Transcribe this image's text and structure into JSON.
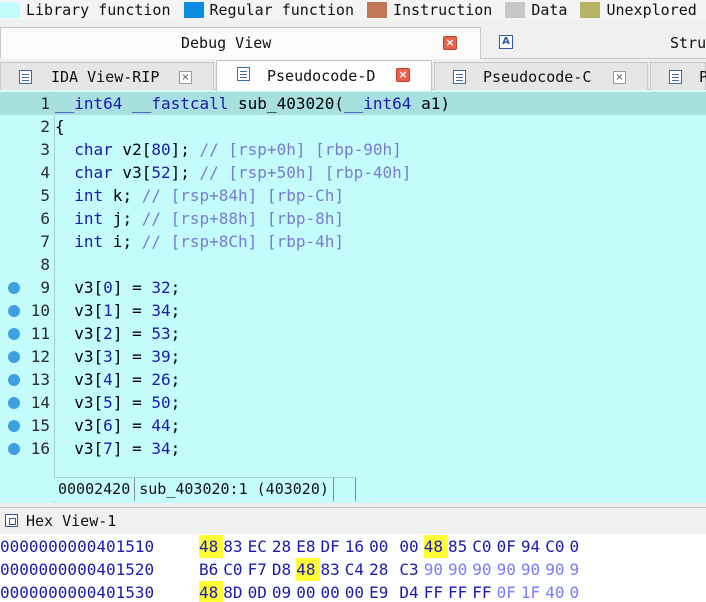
{
  "legend": [
    {
      "label": "Library function",
      "color": "#c4fcfc"
    },
    {
      "label": "Regular function",
      "color": "#0b8ee0"
    },
    {
      "label": "Instruction",
      "color": "#c07858"
    },
    {
      "label": "Data",
      "color": "#c8c8c8"
    },
    {
      "label": "Unexplored",
      "color": "#b4b464"
    }
  ],
  "debug_tab": {
    "label": "Debug View",
    "close": "×"
  },
  "struct_tab": {
    "label": "Stru",
    "icon": "A"
  },
  "sub_tabs": [
    {
      "label": "IDA View-RIP",
      "close": "×"
    },
    {
      "label": "Pseudocode-D",
      "close": "×"
    },
    {
      "label": "Pseudocode-C",
      "close": "×"
    },
    {
      "label": "P"
    }
  ],
  "code": {
    "lines": [
      {
        "num": "1",
        "bp": false,
        "parts": [
          [
            "kw",
            "__int64"
          ],
          [
            "t",
            " "
          ],
          [
            "kw",
            "__fastcall"
          ],
          [
            "t",
            " sub_403020("
          ],
          [
            "kw",
            "__int64"
          ],
          [
            "t",
            " a1)"
          ]
        ]
      },
      {
        "num": "2",
        "bp": false,
        "parts": [
          [
            "t",
            "{"
          ]
        ]
      },
      {
        "num": "3",
        "bp": false,
        "parts": [
          [
            "t",
            "  "
          ],
          [
            "kw",
            "char"
          ],
          [
            "t",
            " v2["
          ],
          [
            "nm",
            "80"
          ],
          [
            "t",
            "]; "
          ],
          [
            "cm",
            "// [rsp+0h] [rbp-90h]"
          ]
        ]
      },
      {
        "num": "4",
        "bp": false,
        "parts": [
          [
            "t",
            "  "
          ],
          [
            "kw",
            "char"
          ],
          [
            "t",
            " v3["
          ],
          [
            "nm",
            "52"
          ],
          [
            "t",
            "]; "
          ],
          [
            "cm",
            "// [rsp+50h] [rbp-40h]"
          ]
        ]
      },
      {
        "num": "5",
        "bp": false,
        "parts": [
          [
            "t",
            "  "
          ],
          [
            "kw",
            "int"
          ],
          [
            "t",
            " k; "
          ],
          [
            "cm",
            "// [rsp+84h] [rbp-Ch]"
          ]
        ]
      },
      {
        "num": "6",
        "bp": false,
        "parts": [
          [
            "t",
            "  "
          ],
          [
            "kw",
            "int"
          ],
          [
            "t",
            " j; "
          ],
          [
            "cm",
            "// [rsp+88h] [rbp-8h]"
          ]
        ]
      },
      {
        "num": "7",
        "bp": false,
        "parts": [
          [
            "t",
            "  "
          ],
          [
            "kw",
            "int"
          ],
          [
            "t",
            " i; "
          ],
          [
            "cm",
            "// [rsp+8Ch] [rbp-4h]"
          ]
        ]
      },
      {
        "num": "8",
        "bp": false,
        "parts": [
          [
            "t",
            ""
          ]
        ]
      },
      {
        "num": "9",
        "bp": true,
        "parts": [
          [
            "t",
            "  v3["
          ],
          [
            "nm",
            "0"
          ],
          [
            "t",
            "] = "
          ],
          [
            "nm",
            "32"
          ],
          [
            "t",
            ";"
          ]
        ]
      },
      {
        "num": "10",
        "bp": true,
        "parts": [
          [
            "t",
            "  v3["
          ],
          [
            "nm",
            "1"
          ],
          [
            "t",
            "] = "
          ],
          [
            "nm",
            "34"
          ],
          [
            "t",
            ";"
          ]
        ]
      },
      {
        "num": "11",
        "bp": true,
        "parts": [
          [
            "t",
            "  v3["
          ],
          [
            "nm",
            "2"
          ],
          [
            "t",
            "] = "
          ],
          [
            "nm",
            "53"
          ],
          [
            "t",
            ";"
          ]
        ]
      },
      {
        "num": "12",
        "bp": true,
        "parts": [
          [
            "t",
            "  v3["
          ],
          [
            "nm",
            "3"
          ],
          [
            "t",
            "] = "
          ],
          [
            "nm",
            "39"
          ],
          [
            "t",
            ";"
          ]
        ]
      },
      {
        "num": "13",
        "bp": true,
        "parts": [
          [
            "t",
            "  v3["
          ],
          [
            "nm",
            "4"
          ],
          [
            "t",
            "] = "
          ],
          [
            "nm",
            "26"
          ],
          [
            "t",
            ";"
          ]
        ]
      },
      {
        "num": "14",
        "bp": true,
        "parts": [
          [
            "t",
            "  v3["
          ],
          [
            "nm",
            "5"
          ],
          [
            "t",
            "] = "
          ],
          [
            "nm",
            "50"
          ],
          [
            "t",
            ";"
          ]
        ]
      },
      {
        "num": "15",
        "bp": true,
        "parts": [
          [
            "t",
            "  v3["
          ],
          [
            "nm",
            "6"
          ],
          [
            "t",
            "] = "
          ],
          [
            "nm",
            "44"
          ],
          [
            "t",
            ";"
          ]
        ]
      },
      {
        "num": "16",
        "bp": true,
        "parts": [
          [
            "t",
            "  v3["
          ],
          [
            "nm",
            "7"
          ],
          [
            "t",
            "] = "
          ],
          [
            "nm",
            "34"
          ],
          [
            "t",
            ";"
          ]
        ]
      }
    ]
  },
  "status": {
    "offset": "00002420",
    "location": "sub_403020:1",
    "address": "(403020)"
  },
  "hex": {
    "title": "Hex View-1",
    "rows": [
      {
        "addr": "0000000000401510",
        "bytes": [
          "48",
          "83",
          "EC",
          "28",
          "E8",
          "DF",
          "16",
          "00",
          "00",
          "48",
          "85",
          "C0",
          "0F",
          "94",
          "C0",
          "0"
        ]
      },
      {
        "addr": "0000000000401520",
        "bytes": [
          "B6",
          "C0",
          "F7",
          "D8",
          "48",
          "83",
          "C4",
          "28",
          "C3",
          "90",
          "90",
          "90",
          "90",
          "90",
          "90",
          "9"
        ]
      },
      {
        "addr": "0000000000401530",
        "bytes": [
          "48",
          "8D",
          "0D",
          "09",
          "00",
          "00",
          "00",
          "E9",
          "D4",
          "FF",
          "FF",
          "FF",
          "0F",
          "1F",
          "40",
          "0"
        ]
      }
    ],
    "highlight": [
      [
        0,
        9
      ],
      [
        1,
        4
      ],
      [
        2,
        0
      ],
      [
        0,
        0
      ]
    ],
    "nop_start": [
      [
        1,
        9
      ],
      [
        2,
        12
      ]
    ]
  }
}
